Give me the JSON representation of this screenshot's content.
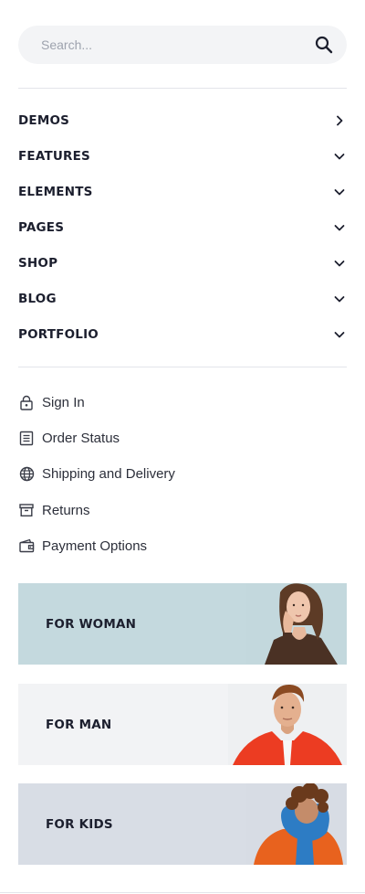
{
  "search": {
    "placeholder": "Search...",
    "icon": "search-icon"
  },
  "nav": [
    {
      "label": "DEMOS",
      "icon": "chevron-right-icon"
    },
    {
      "label": "FEATURES",
      "icon": "chevron-down-icon"
    },
    {
      "label": "ELEMENTS",
      "icon": "chevron-down-icon"
    },
    {
      "label": "PAGES",
      "icon": "chevron-down-icon"
    },
    {
      "label": "SHOP",
      "icon": "chevron-down-icon"
    },
    {
      "label": "BLOG",
      "icon": "chevron-down-icon"
    },
    {
      "label": "PORTFOLIO",
      "icon": "chevron-down-icon"
    }
  ],
  "links": [
    {
      "label": "Sign In",
      "icon": "lock-icon"
    },
    {
      "label": "Order Status",
      "icon": "document-icon"
    },
    {
      "label": "Shipping and Delivery",
      "icon": "globe-icon"
    },
    {
      "label": "Returns",
      "icon": "archive-box-icon"
    },
    {
      "label": "Payment Options",
      "icon": "wallet-icon"
    }
  ],
  "banners": [
    {
      "label": "FOR WOMAN",
      "color": "#c4d9de"
    },
    {
      "label": "FOR MAN",
      "color": "#f2f3f5"
    },
    {
      "label": "FOR KIDS",
      "color": "#d8dde5"
    }
  ]
}
